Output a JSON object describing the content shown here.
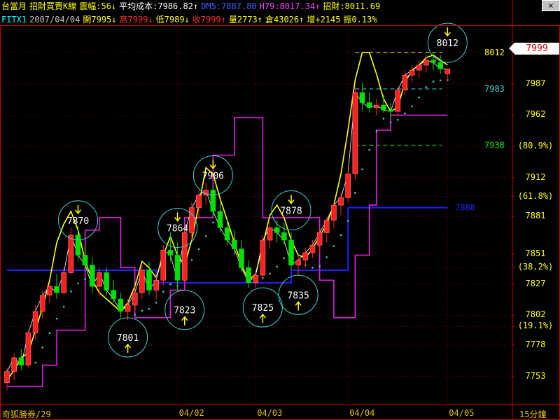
{
  "header": {
    "line1": [
      {
        "text": "台當月",
        "color": "#ffff00"
      },
      {
        "text": "招財買賣K線",
        "color": "#ffff00"
      },
      {
        "text": "震幅:56↓",
        "color": "#ffff00"
      },
      {
        "text": "平均成本:7986.82↑",
        "color": "#ffffff"
      },
      {
        "text": "DM5:7887.80",
        "color": "#4060ff"
      },
      {
        "text": "H79:8017.34↑",
        "color": "#ff40ff"
      },
      {
        "text": "招財:8011.69",
        "color": "#ffff00"
      }
    ],
    "line2": [
      {
        "text": "FITX1",
        "color": "#00ffff"
      },
      {
        "text": "2007/04/04",
        "color": "#c0c0c0"
      },
      {
        "text": "開7995↓",
        "color": "#ffff00"
      },
      {
        "text": "高7999↓",
        "color": "#ff3030"
      },
      {
        "text": "低7989↓",
        "color": "#ffff00"
      },
      {
        "text": "收7999↑",
        "color": "#ff3030"
      },
      {
        "text": "量2773↑",
        "color": "#ffff00"
      },
      {
        "text": "倉43026↑",
        "color": "#ffff00"
      },
      {
        "text": "增+2145",
        "color": "#ffff00"
      },
      {
        "text": "振0.13%",
        "color": "#ffff00"
      }
    ]
  },
  "window_control": "×",
  "current_price": "7999",
  "footer": {
    "left_text": "奇狐勝券/29",
    "right_text": "15分鐘",
    "dates": [
      "04/02",
      "04/03",
      "04/04",
      "04/05"
    ]
  },
  "colors": {
    "up": "#ff2020",
    "down": "#00e000",
    "axis": "#c00000",
    "grid": "#7a0000",
    "yellow": "#ffff00",
    "magenta": "#e020e0",
    "blue": "#2020ff",
    "cyan": "#40d0d0",
    "white": "#ffffff",
    "green_label": "#00e000"
  },
  "chart_data": {
    "type": "candlestick",
    "timeframe": "15分鐘",
    "ylim": [
      7740,
      8030
    ],
    "y_ticks": [
      {
        "value": 8012,
        "label": "8012"
      },
      {
        "value": 7987,
        "label": "7987"
      },
      {
        "value": 7962,
        "label": "7962"
      },
      {
        "value": 7937,
        "label": "(80.9%)"
      },
      {
        "value": 7912,
        "label": "7912"
      },
      {
        "value": 7897,
        "label": "(61.8%)"
      },
      {
        "value": 7881,
        "label": "7881"
      },
      {
        "value": 7851,
        "label": "7851"
      },
      {
        "value": 7840,
        "label": "(38.2%)"
      },
      {
        "value": 7827,
        "label": "7827"
      },
      {
        "value": 7802,
        "label": "7802"
      },
      {
        "value": 7793,
        "label": "(19.1%)"
      },
      {
        "value": 7778,
        "label": "7778"
      },
      {
        "value": 7753,
        "label": "7753"
      }
    ],
    "right_labels": [
      {
        "value": 8012,
        "text": "8012",
        "color": "#ffff00"
      },
      {
        "value": 7983,
        "text": "7983",
        "color": "#40d0d0"
      },
      {
        "value": 7938,
        "text": "7938",
        "color": "#00e000"
      },
      {
        "value": 7888,
        "text": "7888",
        "color": "#2020ff"
      }
    ],
    "annotations": [
      {
        "text": "7870",
        "value": 7870,
        "position": 10
      },
      {
        "text": "7801",
        "value": 7801,
        "position": 17
      },
      {
        "text": "7864",
        "value": 7864,
        "position": 24
      },
      {
        "text": "7823",
        "value": 7823,
        "position": 25
      },
      {
        "text": "7906",
        "value": 7906,
        "position": 29
      },
      {
        "text": "7825",
        "value": 7825,
        "position": 36
      },
      {
        "text": "7878",
        "value": 7878,
        "position": 40
      },
      {
        "text": "7835",
        "value": 7835,
        "position": 41
      },
      {
        "text": "8012",
        "value": 8012,
        "position": 62
      }
    ],
    "candles": [
      [
        7748,
        7760,
        7742,
        7757
      ],
      [
        7757,
        7772,
        7750,
        7768
      ],
      [
        7768,
        7775,
        7758,
        7762
      ],
      [
        7762,
        7790,
        7760,
        7788
      ],
      [
        7788,
        7810,
        7782,
        7805
      ],
      [
        7805,
        7822,
        7800,
        7818
      ],
      [
        7818,
        7828,
        7812,
        7825
      ],
      [
        7825,
        7835,
        7815,
        7820
      ],
      [
        7820,
        7840,
        7818,
        7836
      ],
      [
        7836,
        7872,
        7834,
        7866
      ],
      [
        7866,
        7873,
        7845,
        7850
      ],
      [
        7850,
        7858,
        7838,
        7842
      ],
      [
        7842,
        7848,
        7820,
        7825
      ],
      [
        7825,
        7840,
        7818,
        7836
      ],
      [
        7836,
        7840,
        7818,
        7822
      ],
      [
        7822,
        7830,
        7812,
        7815
      ],
      [
        7815,
        7820,
        7800,
        7805
      ],
      [
        7805,
        7815,
        7798,
        7810
      ],
      [
        7810,
        7825,
        7805,
        7820
      ],
      [
        7820,
        7842,
        7815,
        7838
      ],
      [
        7838,
        7845,
        7818,
        7822
      ],
      [
        7822,
        7835,
        7815,
        7830
      ],
      [
        7830,
        7858,
        7826,
        7854
      ],
      [
        7854,
        7868,
        7845,
        7850
      ],
      [
        7850,
        7860,
        7822,
        7830
      ],
      [
        7830,
        7872,
        7826,
        7868
      ],
      [
        7868,
        7892,
        7862,
        7888
      ],
      [
        7888,
        7902,
        7880,
        7898
      ],
      [
        7898,
        7908,
        7890,
        7902
      ],
      [
        7902,
        7906,
        7880,
        7885
      ],
      [
        7885,
        7892,
        7868,
        7872
      ],
      [
        7872,
        7880,
        7858,
        7862
      ],
      [
        7862,
        7870,
        7850,
        7855
      ],
      [
        7855,
        7862,
        7836,
        7840
      ],
      [
        7840,
        7846,
        7824,
        7828
      ],
      [
        7828,
        7838,
        7824,
        7834
      ],
      [
        7834,
        7866,
        7830,
        7862
      ],
      [
        7862,
        7876,
        7855,
        7872
      ],
      [
        7872,
        7878,
        7860,
        7868
      ],
      [
        7868,
        7876,
        7858,
        7862
      ],
      [
        7862,
        7868,
        7838,
        7842
      ],
      [
        7842,
        7850,
        7834,
        7846
      ],
      [
        7846,
        7856,
        7840,
        7852
      ],
      [
        7852,
        7862,
        7848,
        7858
      ],
      [
        7858,
        7872,
        7852,
        7868
      ],
      [
        7868,
        7880,
        7860,
        7878
      ],
      [
        7878,
        7892,
        7872,
        7890
      ],
      [
        7890,
        7900,
        7882,
        7896
      ],
      [
        7896,
        7918,
        7892,
        7915
      ],
      [
        7915,
        7985,
        7910,
        7980
      ],
      [
        7980,
        7988,
        7966,
        7972
      ],
      [
        7972,
        7980,
        7964,
        7968
      ],
      [
        7968,
        7975,
        7962,
        7970
      ],
      [
        7970,
        7978,
        7964,
        7966
      ],
      [
        7966,
        7972,
        7960,
        7965
      ],
      [
        7965,
        7985,
        7962,
        7982
      ],
      [
        7982,
        7998,
        7978,
        7994
      ],
      [
        7994,
        8002,
        7988,
        7998
      ],
      [
        7998,
        8006,
        7992,
        8002
      ],
      [
        8002,
        8010,
        7996,
        8006
      ],
      [
        8006,
        8012,
        7998,
        8004
      ],
      [
        8004,
        8010,
        7995,
        7999
      ],
      [
        7995,
        7999,
        7989,
        7999
      ]
    ],
    "series": [
      {
        "name": "DM5",
        "color": "#2020ff",
        "values": [
          7838,
          7838,
          7838,
          7838,
          7838,
          7838,
          7838,
          7838,
          7838,
          7838,
          7838,
          7838,
          7838,
          7838,
          7838,
          7838,
          7838,
          7838,
          7838,
          7838,
          7838,
          7828,
          7828,
          7828,
          7828,
          7828,
          7828,
          7828,
          7828,
          7828,
          7828,
          7828,
          7828,
          7828,
          7828,
          7828,
          7828,
          7828,
          7828,
          7828,
          7838,
          7838,
          7838,
          7838,
          7838,
          7838,
          7838,
          7838,
          7888,
          7888,
          7888,
          7888,
          7888,
          7888,
          7888,
          7888,
          7888,
          7888,
          7888,
          7888,
          7888,
          7888,
          7888
        ]
      },
      {
        "name": "H79",
        "color": "#e020e0",
        "values": [
          7745,
          7745,
          7745,
          7745,
          7745,
          7762,
          7762,
          7790,
          7790,
          7790,
          7790,
          7870,
          7870,
          7880,
          7880,
          7880,
          7840,
          7840,
          7800,
          7800,
          7800,
          7800,
          7800,
          7822,
          7822,
          7880,
          7880,
          7880,
          7880,
          7930,
          7930,
          7930,
          7960,
          7960,
          7960,
          7960,
          7880,
          7880,
          7880,
          7880,
          7880,
          7880,
          7880,
          7880,
          7830,
          7830,
          7800,
          7800,
          7800,
          7850,
          7850,
          7890,
          7950,
          7950,
          7962,
          7962,
          7962,
          7962,
          7962,
          7962,
          7962,
          7962,
          7962
        ]
      },
      {
        "name": "招財",
        "color": "#ffff00",
        "values": [
          7750,
          7758,
          7768,
          7772,
          7790,
          7808,
          7830,
          7860,
          7875,
          7885,
          7870,
          7845,
          7830,
          7820,
          7815,
          7810,
          7805,
          7812,
          7825,
          7845,
          7840,
          7832,
          7850,
          7865,
          7850,
          7842,
          7862,
          7890,
          7920,
          7915,
          7895,
          7878,
          7860,
          7842,
          7830,
          7835,
          7858,
          7882,
          7890,
          7880,
          7862,
          7850,
          7848,
          7855,
          7865,
          7875,
          7890,
          7915,
          7950,
          7990,
          8012,
          8012,
          7995,
          7975,
          7965,
          7968,
          7988,
          7998,
          8002,
          8008,
          8010,
          8006,
          8002
        ]
      }
    ]
  }
}
